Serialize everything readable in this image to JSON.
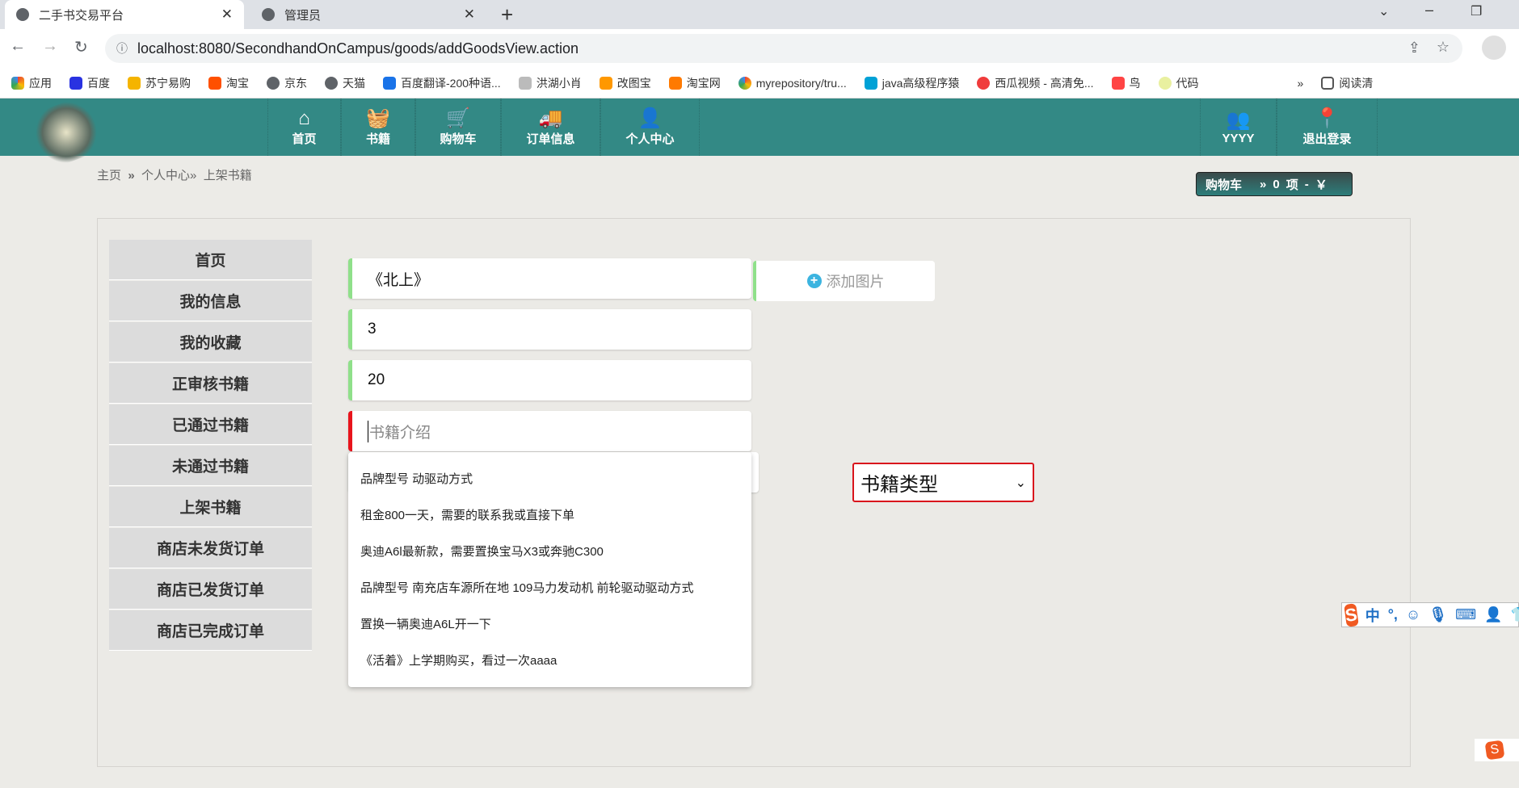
{
  "browser": {
    "tabs": [
      {
        "title": "二手书交易平台"
      },
      {
        "title": "管理员"
      }
    ],
    "url": "localhost:8080/SecondhandOnCampus/goods/addGoodsView.action",
    "bookmarks": [
      "应用",
      "百度",
      "苏宁易购",
      "淘宝",
      "京东",
      "天猫",
      "百度翻译-200种语...",
      "洪湖小肖",
      "改图宝",
      "淘宝网",
      "myrepository/tru...",
      "java高级程序猿",
      "西瓜视频 - 高清免...",
      "鸟",
      "代码"
    ],
    "reading_list": "阅读清"
  },
  "nav": {
    "items": [
      "首页",
      "书籍",
      "购物车",
      "订单信息",
      "个人中心"
    ],
    "user": "YYYY",
    "logout": "退出登录"
  },
  "breadcrumb": [
    "主页",
    "»",
    "个人中心»",
    "上架书籍"
  ],
  "cart": {
    "label": "购物车",
    "arrow": "»",
    "count": "0",
    "unit": "项",
    "sep": "-",
    "currency": "￥"
  },
  "sidebar": {
    "items": [
      "首页",
      "我的信息",
      "我的收藏",
      "正审核书籍",
      "已通过书籍",
      "未通过书籍",
      "上架书籍",
      "商店未发货订单",
      "商店已发货订单",
      "商店已完成订单"
    ]
  },
  "form": {
    "name": "《北上》",
    "field2": "3",
    "field3": "20",
    "intro_placeholder": "书籍介绍",
    "add_image": "添加图片",
    "type_select": "书籍类型"
  },
  "autocomplete": [
    "品牌型号 动驱动方式",
    "租金800一天，需要的联系我或直接下单",
    "奥迪A6l最新款，需要置换宝马X3或奔驰C300",
    "品牌型号 南充店车源所在地 109马力发动机 前轮驱动驱动方式",
    "置换一辆奥迪A6L开一下",
    "《活着》上学期购买，看过一次aaaa"
  ],
  "ime": {
    "mode": "中",
    "punct": "°,"
  }
}
